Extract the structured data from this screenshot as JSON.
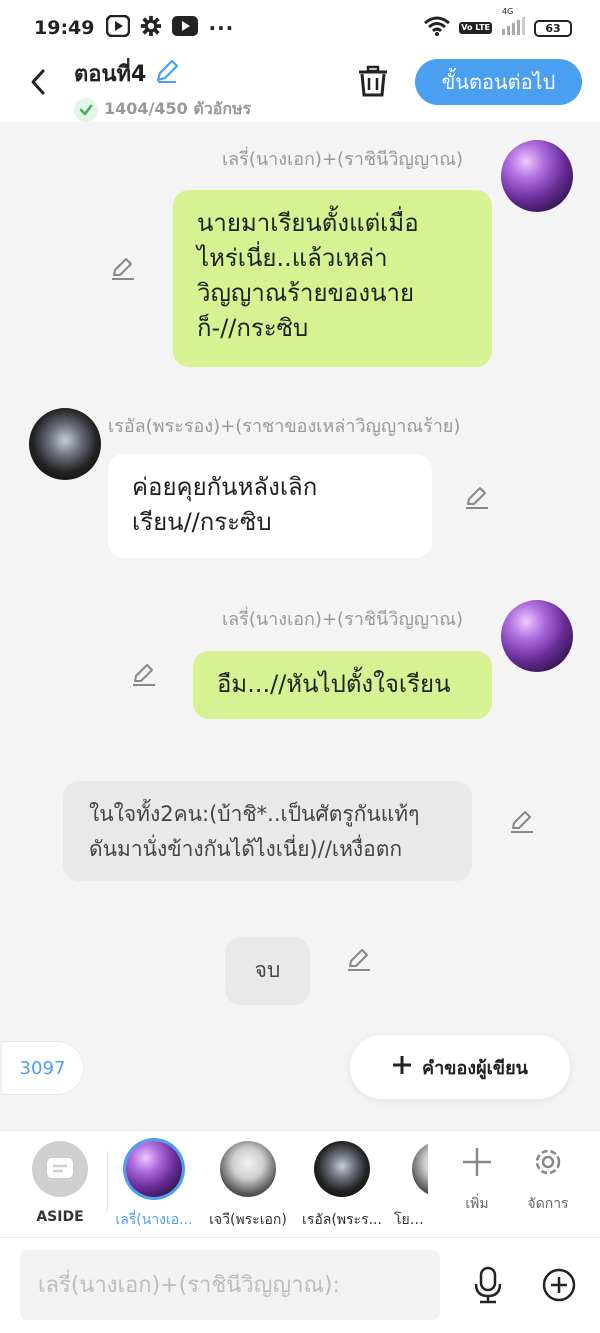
{
  "status_bar": {
    "time": "19:49",
    "battery": "63",
    "network": "4G",
    "volte": "Vo LTE"
  },
  "header": {
    "title": "ตอนที่4",
    "char_count": "1404/450 ตัวอักษร",
    "next_button": "ขั้นตอนต่อไป"
  },
  "messages": [
    {
      "sender": "เลรี่(นางเอก)+(ราชินีวิญญาณ)",
      "side": "right",
      "style": "green",
      "text": "นายมาเรียนตั้งแต่เมื่อ\nไหร่เนี่ย..แล้วเหล่า\nวิญญาณร้ายของนาย\nก็-//กระซิบ"
    },
    {
      "sender": "เรอัล(พระรอง)+(ราชาของเหล่าวิญญาณร้าย)",
      "side": "left",
      "style": "white",
      "text": "ค่อยคุยกันหลังเลิก\nเรียน//กระซิบ"
    },
    {
      "sender": "เลรี่(นางเอก)+(ราชินีวิญญาณ)",
      "side": "right",
      "style": "green",
      "text": "อืม...//หันไปตั้งใจเรียน"
    },
    {
      "sender": "",
      "side": "center",
      "style": "grey",
      "text": "ในใจทั้ง2คน:(บ้าชิ*..เป็นศัตรูกันแท้ๆ\nดันมานั่งข้างกันได้ไงเนี่ย)//เหงื่อตก"
    },
    {
      "sender": "",
      "side": "center",
      "style": "grey",
      "text": "จบ"
    }
  ],
  "counter": "3097",
  "author_button": "คำของผู้เขียน",
  "characters": [
    {
      "label": "ASIDE"
    },
    {
      "label": "เลรี่(นางเอ..."
    },
    {
      "label": "เจวี(พระเอก)"
    },
    {
      "label": "เรอัล(พระร..."
    },
    {
      "label": "โยบิ(เ"
    }
  ],
  "tools": {
    "add": "เพิ่ม",
    "manage": "จัดการ"
  },
  "input": {
    "placeholder": "เลรี่(นางเอก)+(ราชินีวิญญาณ):"
  },
  "colors": {
    "accent": "#4b9ff0",
    "green_bubble": "#d6f292",
    "background": "#f4f4f4"
  }
}
